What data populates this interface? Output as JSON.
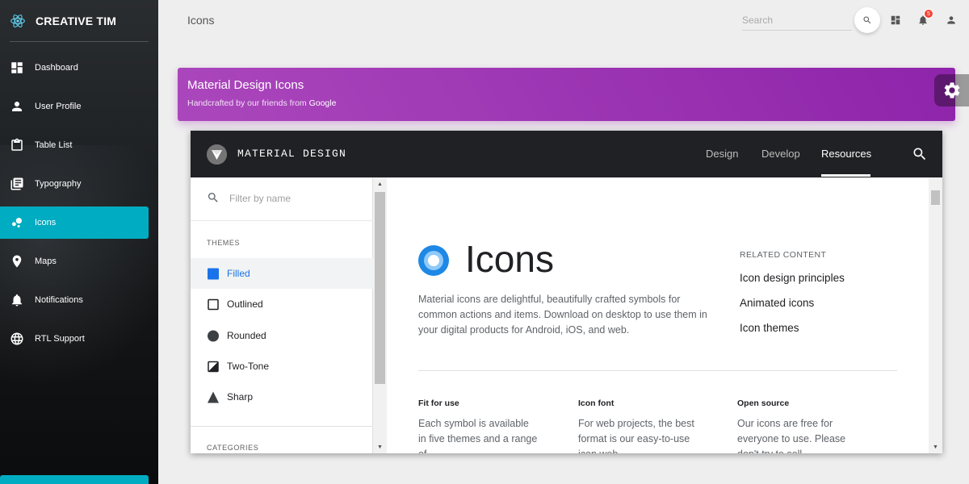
{
  "sidebar": {
    "brand": "CREATIVE TIM",
    "items": [
      {
        "label": "Dashboard",
        "icon": "dashboard-icon"
      },
      {
        "label": "User Profile",
        "icon": "person-icon"
      },
      {
        "label": "Table List",
        "icon": "clipboard-icon"
      },
      {
        "label": "Typography",
        "icon": "library-books-icon"
      },
      {
        "label": "Icons",
        "icon": "bubble-chart-icon",
        "active": true
      },
      {
        "label": "Maps",
        "icon": "location-pin-icon"
      },
      {
        "label": "Notifications",
        "icon": "bell-icon"
      },
      {
        "label": "RTL Support",
        "icon": "globe-icon"
      }
    ],
    "active_color": "#00acc1"
  },
  "navbar": {
    "title": "Icons",
    "search_placeholder": "Search",
    "notification_count": "5"
  },
  "card": {
    "title": "Material Design Icons",
    "subtitle_prefix": "Handcrafted by our friends from ",
    "subtitle_link": "Google",
    "color": "#9c27b0"
  },
  "embed": {
    "brand": "MATERIAL DESIGN",
    "nav": [
      "Design",
      "Develop",
      "Resources"
    ],
    "active_nav": "Resources",
    "filter_placeholder": "Filter by name",
    "themes_label": "THEMES",
    "themes": [
      "Filled",
      "Outlined",
      "Rounded",
      "Two-Tone",
      "Sharp"
    ],
    "active_theme": "Filled",
    "categories_label": "CATEGORIES",
    "main": {
      "title": "Icons",
      "description": "Material icons are delightful, beautifully crafted symbols for common actions and items. Download on desktop to use them in your digital products for Android, iOS, and web.",
      "related_label": "RELATED CONTENT",
      "related_links": [
        "Icon design principles",
        "Animated icons",
        "Icon themes"
      ],
      "features": [
        {
          "title": "Fit for use",
          "body": "Each symbol is available in five themes and a range of"
        },
        {
          "title": "Icon font",
          "body": "For web projects, the best format is our easy-to-use icon web"
        },
        {
          "title": "Open source",
          "body": "Our icons are free for everyone to use. Please don't try to sell"
        }
      ]
    }
  }
}
